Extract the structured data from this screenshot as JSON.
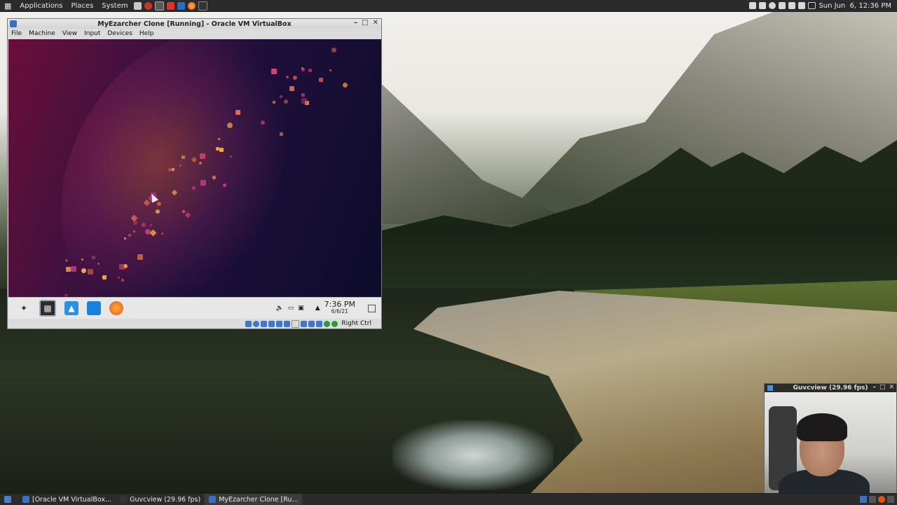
{
  "top_panel": {
    "menus": [
      "Applications",
      "Places",
      "System"
    ],
    "launchers": [
      "document-icon",
      "record-icon",
      "screenshot-icon",
      "terminal-icon",
      "network-icon",
      "firefox-icon",
      "console-icon"
    ],
    "clock": "Sun Jun  6, 12:36 PM"
  },
  "vbox": {
    "title": "MyEzarcher Clone [Running] - Oracle VM VirtualBox",
    "menu": [
      "File",
      "Machine",
      "View",
      "Input",
      "Devices",
      "Help"
    ],
    "status_text": "Right Ctrl"
  },
  "guest": {
    "taskbar_time": "7:36 PM",
    "taskbar_date": "6/6/21"
  },
  "guvcview": {
    "title": "Guvcview (29.96 fps)"
  },
  "bottom_panel": {
    "tasks": [
      {
        "label": "[Oracle VM VirtualBox...",
        "active": false
      },
      {
        "label": "Guvcview (29.96 fps)",
        "active": false
      },
      {
        "label": "MyEzarcher Clone [Ru...",
        "active": true
      }
    ]
  },
  "colors": {
    "panel_bg": "#2b2b2b",
    "guest_accent": "#ff8a3c",
    "vbox_blue": "#3e78c8"
  }
}
